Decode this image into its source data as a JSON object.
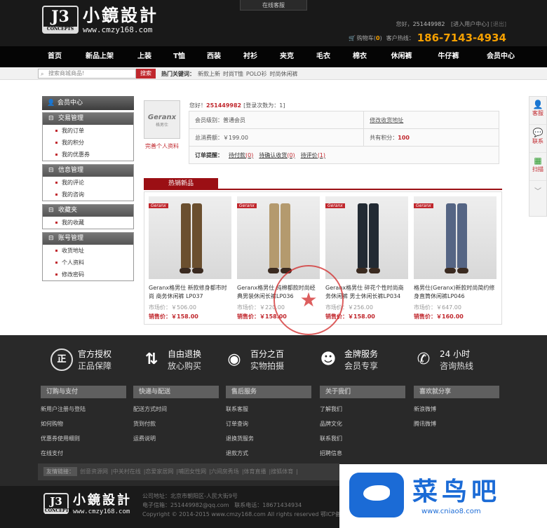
{
  "header": {
    "online_tab": "在线客服",
    "logo_badge": "J3",
    "logo_badge_sub": "CONCEPTS",
    "logo_cn": "小鏡設計",
    "logo_url": "www.cmzy168.com",
    "welcome_prefix": "您好，",
    "user_id": "251449982",
    "user_center": "[进入用户中心]",
    "logout": "[退出]",
    "cart_label": "购物车(",
    "cart_count": "0",
    "cart_suffix": ")",
    "hotline_label": "客户热线：",
    "phone": "186-7143-4934"
  },
  "nav": {
    "items": [
      "首页",
      "新品上架",
      "上装",
      "T恤",
      "西装",
      "衬衫",
      "夹克",
      "毛衣",
      "棉衣",
      "休闲裤",
      "牛仔裤",
      "会员中心"
    ]
  },
  "search": {
    "placeholder": "搜索商城商品!",
    "button": "搜索",
    "hot_label": "热门关键词：",
    "keywords": [
      "新款上新",
      "时尚T恤",
      "POLO衫",
      "时尚休闲裤"
    ]
  },
  "sidebar": {
    "title": "会员中心",
    "groups": [
      {
        "title": "交易管理",
        "items": [
          "我的订单",
          "我的积分",
          "我的优惠券"
        ]
      },
      {
        "title": "信息管理",
        "items": [
          "我的评论",
          "我的咨询"
        ]
      },
      {
        "title": "收藏夹",
        "items": [
          "我的收藏"
        ]
      },
      {
        "title": "账号管理",
        "items": [
          "收货地址",
          "个人资料",
          "修改密码"
        ]
      }
    ]
  },
  "profile": {
    "avatar_brand": "Geranx",
    "avatar_sub": "格男仕",
    "complete_link": "完善个人资料",
    "greet_prefix": "您好！",
    "greet_id": "251449982",
    "greet_suffix": "[登录次数为：1]",
    "level_label": "会员级别：普通会员",
    "address_link": "修改收货地址",
    "spent_label": "总消费额：￥199.00",
    "points_label": "共有积分：",
    "points_value": "100",
    "order_label": "订单提醒：",
    "pending_pay": "待付款",
    "pending_pay_n": "(0)",
    "pending_recv": "待确认收货",
    "pending_recv_n": "(0)",
    "pending_review": "待评价",
    "pending_review_n": "(1)"
  },
  "hot": {
    "tab": "热销新品",
    "products": [
      {
        "tag": "Geranx",
        "name": "Geranx格男仕 新款修身都市时尚 商务休闲裤 LP037",
        "market": "市场价：￥506.00",
        "sale_label": "销售价：",
        "sale": "￥158.00",
        "pant_color": "#6b4f2f"
      },
      {
        "tag": "Geranx",
        "name": "Geranx格男仕 纯棉都款时尚经典男装休闲长裤LP036",
        "market": "市场价：￥220.00",
        "sale_label": "销售价：",
        "sale": "￥158.00",
        "pant_color": "#b49a6e"
      },
      {
        "tag": "Geranx",
        "name": "Geranx格男仕 碎花个性时尚商务休闲裤 男士休闲长裤LP034",
        "market": "市场价：￥256.00",
        "sale_label": "销售价：",
        "sale": "￥158.00",
        "pant_color": "#222a33"
      },
      {
        "tag": "Geranx",
        "name": "格男仕(Geranx)新款时尚简约修身直筒休闲裤LP046",
        "market": "市场价：￥647.00",
        "sale_label": "销售价：",
        "sale": "￥160.00",
        "pant_color": "#556584"
      }
    ]
  },
  "rightbar": {
    "items": [
      {
        "icon": "user-icon",
        "label": "客服"
      },
      {
        "icon": "chat-icon",
        "label": "联系"
      },
      {
        "icon": "qrcode-icon",
        "label": "扫描"
      }
    ]
  },
  "footer": {
    "services": [
      {
        "icon": "正",
        "l1": "官方授权",
        "l2": "正品保障"
      },
      {
        "icon": "⇅",
        "l1": "自由退换",
        "l2": "放心购买"
      },
      {
        "icon": "◉",
        "l1": "百分之百",
        "l2": "实物拍摄"
      },
      {
        "icon": "☻",
        "l1": "金牌服务",
        "l2": "会员专享"
      },
      {
        "icon": "✆",
        "l1": "24 小时",
        "l2": "咨询热线"
      }
    ],
    "columns": [
      {
        "title": "订购与支付",
        "links": [
          "新用户注册与登陆",
          "如何购物",
          "优惠券使用细则",
          "在线支付"
        ]
      },
      {
        "title": "快递与配送",
        "links": [
          "配送方式时间",
          "货到付款",
          "运费说明"
        ]
      },
      {
        "title": "售后服务",
        "links": [
          "联系客服",
          "订单查询",
          "退换货服务",
          "退款方式"
        ]
      },
      {
        "title": "关于我们",
        "links": [
          "了解我们",
          "品牌文化",
          "联系我们",
          "招聘信息"
        ]
      },
      {
        "title": "喜欢就分享",
        "links": [
          "新浪微博",
          "腾讯微博"
        ]
      }
    ],
    "links_label": "友情链接：",
    "friend_links": [
      "创意资源网",
      "|中关村在线",
      "|恋爱家居网",
      "|哺团女性网",
      "|六间房秀场",
      "|体育直播",
      "|搜狐体育",
      "|"
    ],
    "company_address": "公司地址：北京市朝阳区-人民大街9号",
    "company_email": "电子信箱：251449982@qq.com",
    "company_phone": "联系电话：18671434934",
    "copyright": "Copyright © 2014-2015 www.cmzy168.com All rights reserved 鄂ICP备16031"
  },
  "watermark": {
    "cn": "菜鸟吧",
    "url": "www.cniao8.com"
  }
}
